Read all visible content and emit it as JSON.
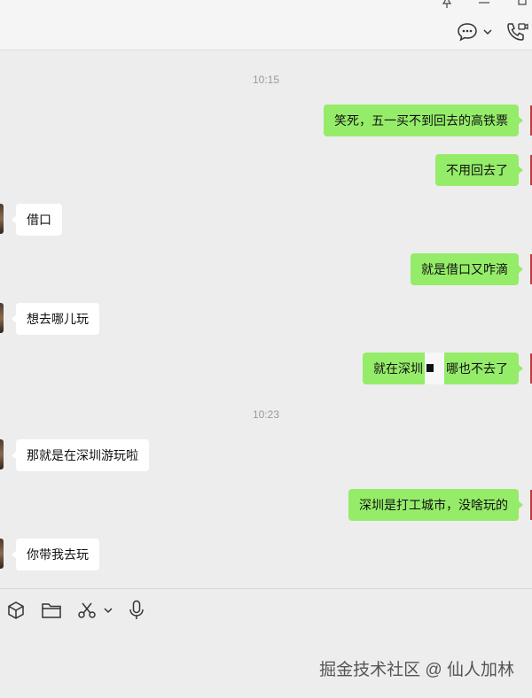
{
  "window": {
    "pin_icon": "pin-icon",
    "minimize_icon": "minimize-icon",
    "maximize_icon": "maximize-icon"
  },
  "header": {
    "chat_icon": "chat-bubble-icon",
    "dropdown_icon": "chevron-down-icon",
    "call_icon": "video-call-icon"
  },
  "messages": [
    {
      "type": "time",
      "text": "10:15"
    },
    {
      "type": "me",
      "text": "笑死，五一买不到回去的高铁票"
    },
    {
      "type": "me",
      "text": "不用回去了"
    },
    {
      "type": "them",
      "text": "借口"
    },
    {
      "type": "me",
      "text": "就是借口又咋滴"
    },
    {
      "type": "them",
      "text": "想去哪儿玩"
    },
    {
      "type": "me",
      "text_before": "就在深圳",
      "text_after": "哪也不去了"
    },
    {
      "type": "time",
      "text": "10:23"
    },
    {
      "type": "them",
      "text": "那就是在深圳游玩啦"
    },
    {
      "type": "me",
      "text": "深圳是打工城市，没啥玩的"
    },
    {
      "type": "them",
      "text": "你带我去玩"
    }
  ],
  "toolbar": {
    "sticker_icon": "cube-icon",
    "folder_icon": "folder-icon",
    "scissors_icon": "scissors-icon",
    "scissors_dropdown_icon": "chevron-down-icon",
    "mic_icon": "microphone-icon"
  },
  "watermark": "掘金技术社区 @ 仙人加林"
}
